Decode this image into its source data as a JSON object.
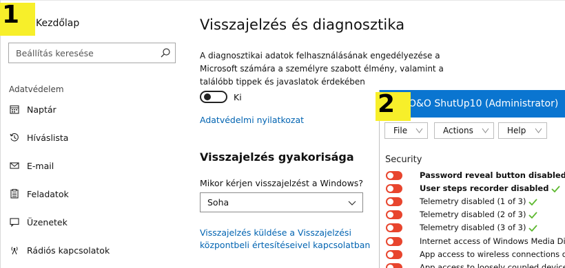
{
  "settings": {
    "home_label": "Kezdőlap",
    "search_placeholder": "Beállítás keresése",
    "nav_section": "Adatvédelem",
    "nav_items": [
      {
        "label": "Naptár",
        "icon": "calendar-icon"
      },
      {
        "label": "Híváslista",
        "icon": "call-history-icon"
      },
      {
        "label": "E-mail",
        "icon": "mail-icon"
      },
      {
        "label": "Feladatok",
        "icon": "tasks-icon"
      },
      {
        "label": "Üzenetek",
        "icon": "message-icon"
      },
      {
        "label": "Rádiós kapcsolatok",
        "icon": "radio-antenna-icon"
      }
    ],
    "page_title": "Visszajelzés és diagnosztika",
    "description": "A diagnosztikai adatok felhasználásának engedélyezése a Microsoft számára a személyre szabott élmény, valamint a találóbb tippek és javaslatok érdekében",
    "toggle_state": "Ki",
    "privacy_link": "Adatvédelmi nyilatkozat",
    "frequency_title": "Visszajelzés gyakorisága",
    "frequency_question": "Mikor kérjen visszajelzést a Windows?",
    "frequency_value": "Soha",
    "feedback_link": "Visszajelzés küldése a Visszajelzési központbeli értesítéseivel kapcsolatban"
  },
  "shutup": {
    "title": "O&O ShutUp10 (Administrator)",
    "menus": [
      "File",
      "Actions",
      "Help"
    ],
    "section": "Security",
    "rows": [
      {
        "text": "Password reveal button disabled",
        "bold": true,
        "check": true
      },
      {
        "text": "User steps recorder disabled",
        "bold": true,
        "check": true
      },
      {
        "text": "Telemetry disabled (1 of 3)",
        "bold": false,
        "check": true
      },
      {
        "text": "Telemetry disabled (2 of 3)",
        "bold": false,
        "check": true
      },
      {
        "text": "Telemetry disabled (3 of 3)",
        "bold": false,
        "check": true
      },
      {
        "text": "Internet access of Windows Media Digital",
        "bold": false,
        "check": false
      },
      {
        "text": "App access to wireless connections disab",
        "bold": false,
        "check": false
      },
      {
        "text": "App access to loosely coupled devices dis",
        "bold": false,
        "check": false
      }
    ],
    "toggle_color": "#e8452e",
    "check_color": "#5cb82e",
    "titlebar_color": "#0a75d0"
  },
  "badges": {
    "one": "1",
    "two": "2",
    "color": "#f7ef2a"
  }
}
